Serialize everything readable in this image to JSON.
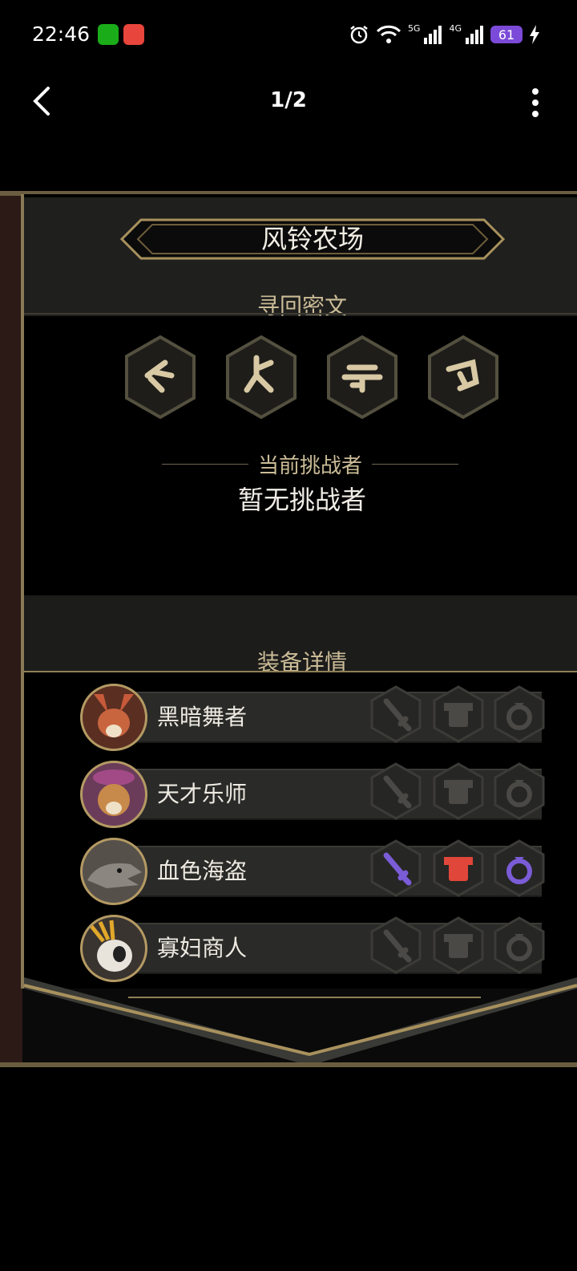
{
  "status_bar": {
    "time": "22:46",
    "net1": "5G",
    "net2": "4G",
    "battery": "61"
  },
  "nav": {
    "pager": "1/2"
  },
  "game": {
    "title": "风铃农场",
    "runes_title": "寻回密文",
    "challenger_label": "当前挑战者",
    "challenger_value": "暂无挑战者",
    "equipment_title": "装备详情",
    "heroes": [
      {
        "name": "黑暗舞者",
        "equipped": false
      },
      {
        "name": "天才乐师",
        "equipped": false
      },
      {
        "name": "血色海盗",
        "equipped": true
      },
      {
        "name": "寡妇商人",
        "equipped": false
      }
    ],
    "colors": {
      "gold": "#b49a63",
      "equipped_weapon": "#7a5cd6",
      "equipped_armor": "#e0463a",
      "equipped_ring": "#7a5cd6"
    }
  }
}
